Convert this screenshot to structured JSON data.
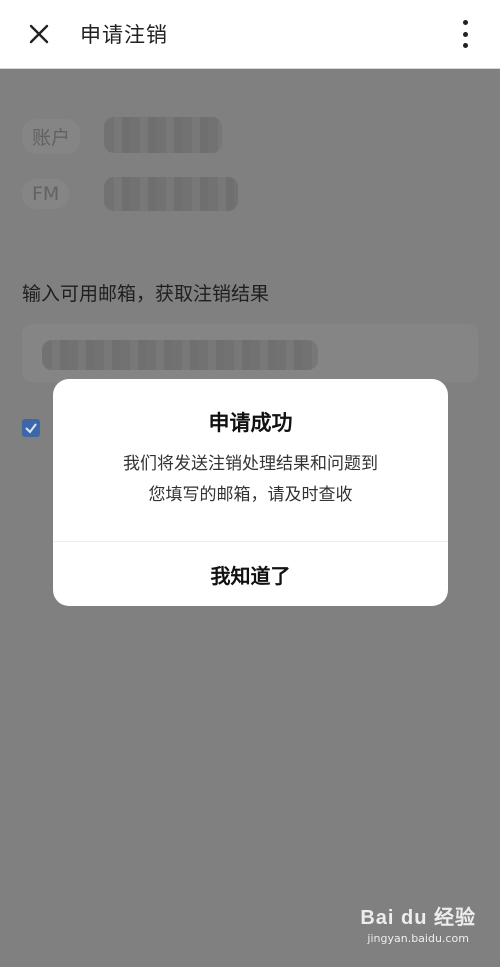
{
  "header": {
    "title": "申请注销"
  },
  "form": {
    "account_label": "账户",
    "fm_label": "FM",
    "email_prompt": "输入可用邮箱，获取注销结果",
    "agree_checked": true
  },
  "dialog": {
    "title": "申请成功",
    "message_line1": "我们将发送注销处理结果和问题到",
    "message_line2": "您填写的邮箱，请及时查收",
    "confirm_label": "我知道了"
  },
  "watermark": {
    "logo": "Bai du 经验",
    "url": "jingyan.baidu.com"
  }
}
